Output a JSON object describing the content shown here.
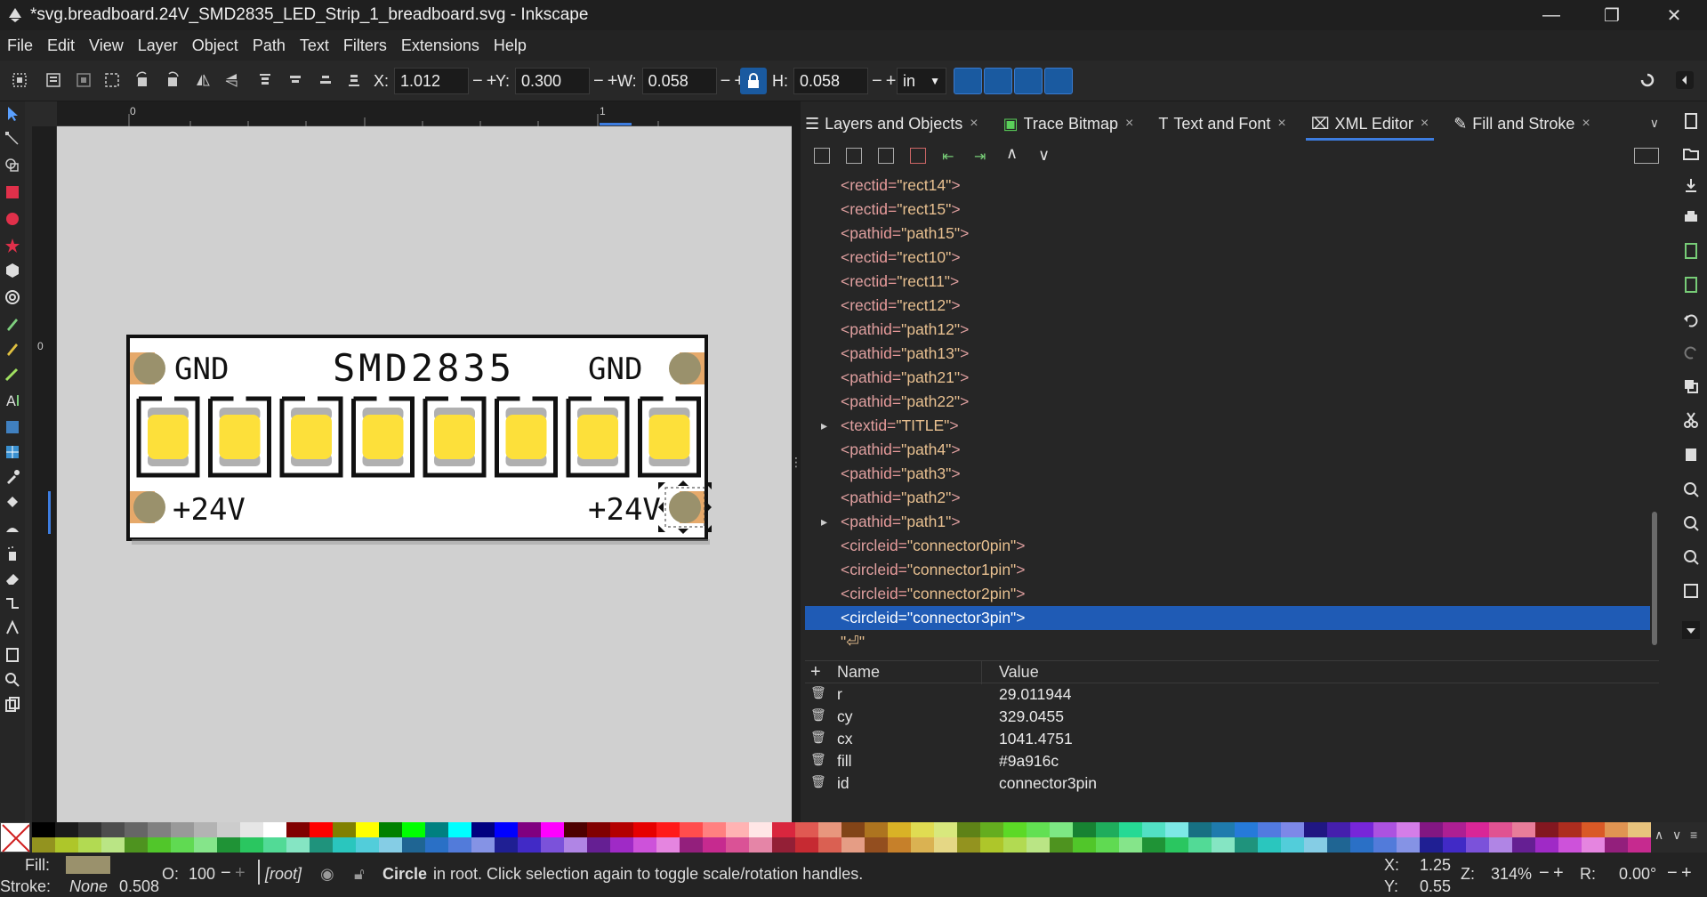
{
  "window": {
    "title": "*svg.breadboard.24V_SMD2835_LED_Strip_1_breadboard.svg - Inkscape",
    "minimize": "—",
    "maximize": "❐",
    "close": "✕"
  },
  "menu": [
    "File",
    "Edit",
    "View",
    "Layer",
    "Object",
    "Path",
    "Text",
    "Filters",
    "Extensions",
    "Help"
  ],
  "toolbar": {
    "x_label": "X:",
    "x_value": "1.012",
    "y_label": "Y:",
    "y_value": "0.300",
    "w_label": "W:",
    "w_value": "0.058",
    "h_label": "H:",
    "h_value": "0.058",
    "unit": "in",
    "minus": "−",
    "plus": "+"
  },
  "ruler": {
    "zero": "0",
    "one": "1",
    "left_zero": "0"
  },
  "canvas": {
    "strip_title": "SMD2835",
    "gnd_left": "GND",
    "gnd_right": "GND",
    "v_left": "+24V",
    "v_right": "+24V",
    "led_count": 8,
    "colors": {
      "pad": "#e6a96a",
      "pin": "#9a916c",
      "led": "#fde03a",
      "led_cap": "#b0b0b0"
    }
  },
  "dock": {
    "tabs": [
      {
        "label": "Layers and Objects",
        "close": "×"
      },
      {
        "label": "Trace Bitmap",
        "close": "×"
      },
      {
        "label": "Text and Font",
        "close": "×"
      },
      {
        "label": "XML Editor",
        "close": "×"
      },
      {
        "label": "Fill and Stroke",
        "close": "×"
      }
    ]
  },
  "xml_nodes": [
    {
      "tag": "rect",
      "id": "rect14",
      "expand": false
    },
    {
      "tag": "rect",
      "id": "rect15",
      "expand": false
    },
    {
      "tag": "path",
      "id": "path15",
      "expand": false
    },
    {
      "tag": "rect",
      "id": "rect10",
      "expand": false
    },
    {
      "tag": "rect",
      "id": "rect11",
      "expand": false
    },
    {
      "tag": "rect",
      "id": "rect12",
      "expand": false
    },
    {
      "tag": "path",
      "id": "path12",
      "expand": false
    },
    {
      "tag": "path",
      "id": "path13",
      "expand": false
    },
    {
      "tag": "path",
      "id": "path21",
      "expand": false
    },
    {
      "tag": "path",
      "id": "path22",
      "expand": false
    },
    {
      "tag": "text",
      "id": "TITLE",
      "expand": true
    },
    {
      "tag": "path",
      "id": "path4",
      "expand": false
    },
    {
      "tag": "path",
      "id": "path3",
      "expand": false
    },
    {
      "tag": "path",
      "id": "path2",
      "expand": false
    },
    {
      "tag": "path",
      "id": "path1",
      "expand": true
    },
    {
      "tag": "circle",
      "id": "connector0pin",
      "expand": false
    },
    {
      "tag": "circle",
      "id": "connector1pin",
      "expand": false
    },
    {
      "tag": "circle",
      "id": "connector2pin",
      "expand": false
    },
    {
      "tag": "circle",
      "id": "connector3pin",
      "expand": false,
      "selected": true
    }
  ],
  "xml_text_node": "\"⏎\"",
  "attributes": {
    "header_name": "Name",
    "header_value": "Value",
    "add": "+",
    "rows": [
      {
        "name": "r",
        "value": "29.011944"
      },
      {
        "name": "cy",
        "value": "329.0455"
      },
      {
        "name": "cx",
        "value": "1041.4751"
      },
      {
        "name": "fill",
        "value": "#9a916c"
      },
      {
        "name": "id",
        "value": "connector3pin"
      }
    ]
  },
  "status": {
    "fill_label": "Fill:",
    "fill_color": "#9a916c",
    "stroke_label": "Stroke:",
    "stroke_value": "None",
    "stroke_width": "0.508",
    "opacity_label": "O:",
    "opacity_value": "100",
    "layer": "[root]",
    "object_type": "Circle",
    "message": "in root. Click selection again to toggle scale/rotation handles.",
    "cx_label": "X:",
    "cx_value": "1.25",
    "cy_label": "Y:",
    "cy_value": "0.55",
    "zoom_label": "Z:",
    "zoom_value": "314%",
    "rot_label": "R:",
    "rot_value": "0.00°"
  }
}
